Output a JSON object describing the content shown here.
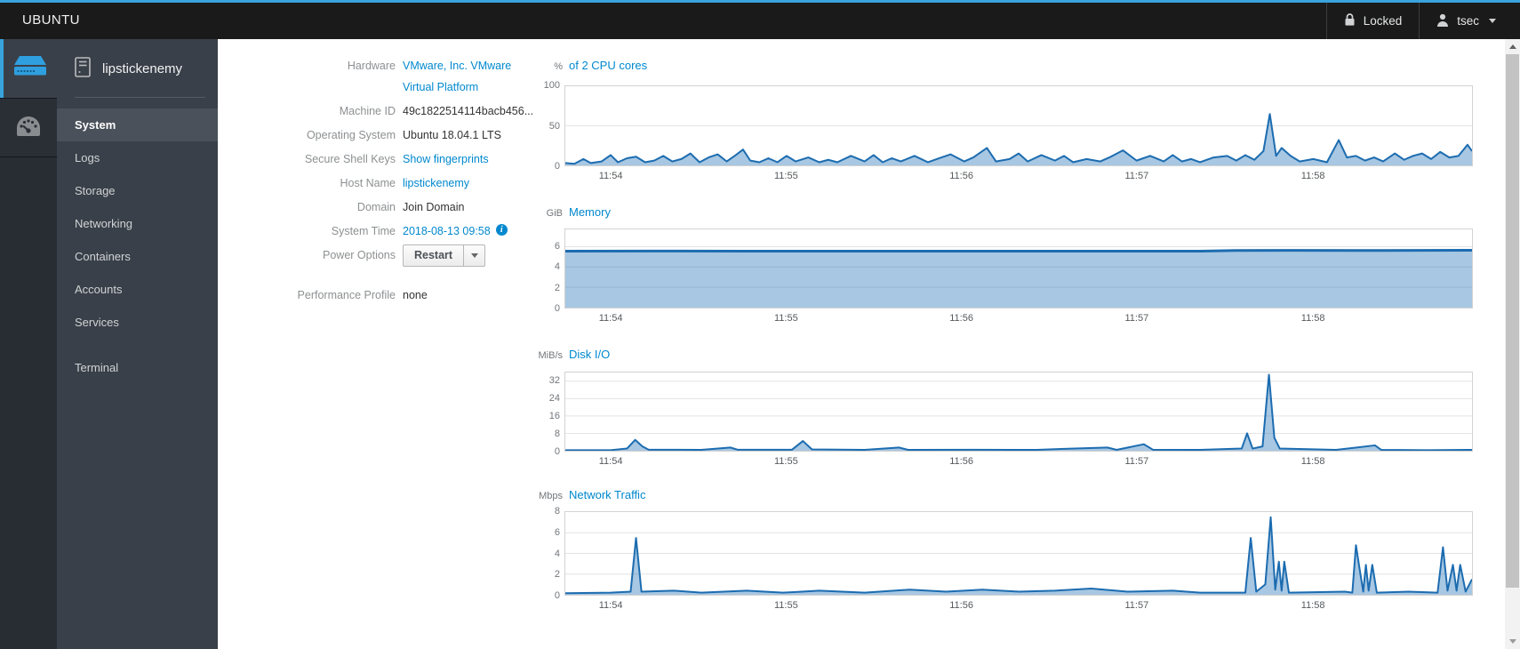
{
  "masthead": {
    "brand": "UBUNTU",
    "locked_label": "Locked",
    "user": "tsec"
  },
  "sidebar": {
    "host": "lipstickenemy",
    "items": [
      {
        "label": "System",
        "selected": true
      },
      {
        "label": "Logs"
      },
      {
        "label": "Storage"
      },
      {
        "label": "Networking"
      },
      {
        "label": "Containers"
      },
      {
        "label": "Accounts"
      },
      {
        "label": "Services"
      },
      {
        "label": "Terminal",
        "separated": true
      }
    ]
  },
  "system": {
    "fields": [
      {
        "key": "hardware",
        "label": "Hardware",
        "lines": [
          "VMware, Inc. VMware",
          "Virtual Platform"
        ],
        "style": "link",
        "interactable": true
      },
      {
        "key": "machine-id",
        "label": "Machine ID",
        "value": "49c1822514114bacb456...",
        "style": "text",
        "interactable": false
      },
      {
        "key": "operating-system",
        "label": "Operating System",
        "value": "Ubuntu 18.04.1 LTS",
        "style": "text",
        "interactable": false
      },
      {
        "key": "secure-shell-keys",
        "label": "Secure Shell Keys",
        "value": "Show fingerprints",
        "style": "link",
        "interactable": true
      },
      {
        "key": "host-name",
        "label": "Host Name",
        "value": "lipstickenemy",
        "style": "link",
        "interactable": true
      },
      {
        "key": "domain",
        "label": "Domain",
        "value": "Join Domain",
        "style": "text",
        "interactable": true
      },
      {
        "key": "system-time",
        "label": "System Time",
        "value": "2018-08-13 09:58",
        "style": "link",
        "icon": "info-icon",
        "interactable": true
      },
      {
        "key": "power-options",
        "label": "Power Options",
        "value": "Restart",
        "style": "button",
        "interactable": true
      },
      {
        "key": "performance-profile",
        "label": "Performance Profile",
        "value": "none",
        "style": "text",
        "interactable": false
      }
    ]
  },
  "chart_data": [
    {
      "type": "area",
      "id": "cpu",
      "unit": "%",
      "title": "of 2 CPU cores",
      "ylabel": "percent",
      "ylim": [
        0,
        100
      ],
      "yticks": [
        100,
        50,
        0
      ],
      "grid": true,
      "legend": "none",
      "x_labels": [
        "11:54",
        "11:55",
        "11:56",
        "11:57",
        "11:58"
      ],
      "x_label_fracs": [
        0.051,
        0.244,
        0.437,
        0.63,
        0.824
      ],
      "series": [
        [
          0,
          3
        ],
        [
          0.01,
          2
        ],
        [
          0.02,
          8
        ],
        [
          0.028,
          3
        ],
        [
          0.04,
          5
        ],
        [
          0.05,
          13
        ],
        [
          0.058,
          4
        ],
        [
          0.068,
          9
        ],
        [
          0.078,
          11
        ],
        [
          0.088,
          4
        ],
        [
          0.098,
          6
        ],
        [
          0.108,
          12
        ],
        [
          0.118,
          5
        ],
        [
          0.128,
          8
        ],
        [
          0.138,
          15
        ],
        [
          0.148,
          4
        ],
        [
          0.158,
          10
        ],
        [
          0.168,
          14
        ],
        [
          0.178,
          5
        ],
        [
          0.188,
          13
        ],
        [
          0.196,
          20
        ],
        [
          0.204,
          6
        ],
        [
          0.214,
          4
        ],
        [
          0.224,
          9
        ],
        [
          0.234,
          4
        ],
        [
          0.244,
          12
        ],
        [
          0.254,
          5
        ],
        [
          0.268,
          10
        ],
        [
          0.28,
          4
        ],
        [
          0.29,
          7
        ],
        [
          0.3,
          4
        ],
        [
          0.315,
          12
        ],
        [
          0.33,
          5
        ],
        [
          0.34,
          13
        ],
        [
          0.35,
          4
        ],
        [
          0.36,
          9
        ],
        [
          0.37,
          5
        ],
        [
          0.385,
          12
        ],
        [
          0.4,
          4
        ],
        [
          0.41,
          8
        ],
        [
          0.425,
          14
        ],
        [
          0.44,
          5
        ],
        [
          0.45,
          10
        ],
        [
          0.465,
          22
        ],
        [
          0.475,
          5
        ],
        [
          0.49,
          8
        ],
        [
          0.5,
          15
        ],
        [
          0.51,
          5
        ],
        [
          0.525,
          13
        ],
        [
          0.54,
          6
        ],
        [
          0.55,
          12
        ],
        [
          0.56,
          4
        ],
        [
          0.575,
          8
        ],
        [
          0.59,
          5
        ],
        [
          0.6,
          10
        ],
        [
          0.615,
          19
        ],
        [
          0.63,
          6
        ],
        [
          0.645,
          12
        ],
        [
          0.66,
          5
        ],
        [
          0.67,
          13
        ],
        [
          0.68,
          5
        ],
        [
          0.69,
          8
        ],
        [
          0.7,
          4
        ],
        [
          0.715,
          10
        ],
        [
          0.73,
          12
        ],
        [
          0.74,
          6
        ],
        [
          0.75,
          13
        ],
        [
          0.76,
          7
        ],
        [
          0.77,
          18
        ],
        [
          0.777,
          65
        ],
        [
          0.784,
          12
        ],
        [
          0.79,
          22
        ],
        [
          0.8,
          12
        ],
        [
          0.81,
          5
        ],
        [
          0.825,
          8
        ],
        [
          0.84,
          4
        ],
        [
          0.853,
          32
        ],
        [
          0.862,
          10
        ],
        [
          0.872,
          12
        ],
        [
          0.882,
          6
        ],
        [
          0.892,
          10
        ],
        [
          0.902,
          5
        ],
        [
          0.915,
          15
        ],
        [
          0.925,
          7
        ],
        [
          0.935,
          12
        ],
        [
          0.945,
          15
        ],
        [
          0.955,
          8
        ],
        [
          0.965,
          17
        ],
        [
          0.975,
          10
        ],
        [
          0.985,
          12
        ],
        [
          0.995,
          26
        ],
        [
          1,
          18
        ]
      ]
    },
    {
      "type": "area",
      "id": "memory",
      "unit": "GiB",
      "title": "Memory",
      "ylabel": "GiB used",
      "ylim": [
        0,
        7.7
      ],
      "yticks": [
        6,
        4,
        2,
        0
      ],
      "grid": true,
      "legend": "none",
      "x_labels": [
        "11:54",
        "11:55",
        "11:56",
        "11:57",
        "11:58"
      ],
      "x_label_fracs": [
        0.051,
        0.244,
        0.437,
        0.63,
        0.824
      ],
      "series": [
        [
          0,
          5.55
        ],
        [
          0.1,
          5.57
        ],
        [
          0.2,
          5.55
        ],
        [
          0.3,
          5.56
        ],
        [
          0.4,
          5.55
        ],
        [
          0.5,
          5.56
        ],
        [
          0.6,
          5.55
        ],
        [
          0.7,
          5.55
        ],
        [
          0.74,
          5.62
        ],
        [
          0.8,
          5.63
        ],
        [
          0.9,
          5.62
        ],
        [
          1,
          5.65
        ]
      ]
    },
    {
      "type": "area",
      "id": "disk",
      "unit": "MiB/s",
      "title": "Disk I/O",
      "ylabel": "MiB per second",
      "ylim": [
        0,
        36
      ],
      "yticks": [
        32,
        24,
        16,
        8,
        0
      ],
      "grid": true,
      "legend": "none",
      "x_labels": [
        "11:54",
        "11:55",
        "11:56",
        "11:57",
        "11:58"
      ],
      "x_label_fracs": [
        0.051,
        0.244,
        0.437,
        0.63,
        0.824
      ],
      "series": [
        [
          0,
          0.3
        ],
        [
          0.05,
          0.3
        ],
        [
          0.068,
          1
        ],
        [
          0.077,
          5
        ],
        [
          0.085,
          2
        ],
        [
          0.092,
          0.5
        ],
        [
          0.15,
          0.4
        ],
        [
          0.182,
          1.5
        ],
        [
          0.19,
          0.5
        ],
        [
          0.25,
          0.5
        ],
        [
          0.262,
          4.5
        ],
        [
          0.272,
          0.6
        ],
        [
          0.33,
          0.4
        ],
        [
          0.368,
          1.5
        ],
        [
          0.378,
          0.4
        ],
        [
          0.45,
          0.5
        ],
        [
          0.52,
          0.4
        ],
        [
          0.55,
          0.9
        ],
        [
          0.598,
          1.5
        ],
        [
          0.608,
          0.4
        ],
        [
          0.638,
          3
        ],
        [
          0.648,
          0.5
        ],
        [
          0.7,
          0.4
        ],
        [
          0.746,
          1
        ],
        [
          0.752,
          8
        ],
        [
          0.758,
          1
        ],
        [
          0.769,
          2
        ],
        [
          0.776,
          35
        ],
        [
          0.782,
          6
        ],
        [
          0.788,
          1
        ],
        [
          0.85,
          0.4
        ],
        [
          0.893,
          2.5
        ],
        [
          0.9,
          0.4
        ],
        [
          0.95,
          0.3
        ],
        [
          1,
          0.4
        ]
      ]
    },
    {
      "type": "area",
      "id": "network",
      "unit": "Mbps",
      "title": "Network Traffic",
      "ylabel": "Mbps",
      "ylim": [
        0,
        8
      ],
      "yticks": [
        8,
        6,
        4,
        2,
        0
      ],
      "grid": true,
      "legend": "none",
      "x_labels": [
        "11:54",
        "11:55",
        "11:56",
        "11:57",
        "11:58"
      ],
      "x_label_fracs": [
        0.051,
        0.244,
        0.437,
        0.63,
        0.824
      ],
      "series": [
        [
          0,
          0.15
        ],
        [
          0.05,
          0.2
        ],
        [
          0.072,
          0.3
        ],
        [
          0.078,
          5.5
        ],
        [
          0.084,
          0.3
        ],
        [
          0.12,
          0.4
        ],
        [
          0.15,
          0.2
        ],
        [
          0.2,
          0.4
        ],
        [
          0.24,
          0.2
        ],
        [
          0.28,
          0.4
        ],
        [
          0.33,
          0.2
        ],
        [
          0.38,
          0.5
        ],
        [
          0.42,
          0.3
        ],
        [
          0.46,
          0.5
        ],
        [
          0.5,
          0.3
        ],
        [
          0.54,
          0.4
        ],
        [
          0.58,
          0.6
        ],
        [
          0.62,
          0.3
        ],
        [
          0.67,
          0.4
        ],
        [
          0.7,
          0.2
        ],
        [
          0.75,
          0.2
        ],
        [
          0.756,
          5.5
        ],
        [
          0.762,
          0.3
        ],
        [
          0.772,
          1
        ],
        [
          0.778,
          7.5
        ],
        [
          0.783,
          0.5
        ],
        [
          0.787,
          3.2
        ],
        [
          0.79,
          0.4
        ],
        [
          0.793,
          3.2
        ],
        [
          0.798,
          0.2
        ],
        [
          0.86,
          0.3
        ],
        [
          0.868,
          0.2
        ],
        [
          0.872,
          4.8
        ],
        [
          0.876,
          2.5
        ],
        [
          0.88,
          0.3
        ],
        [
          0.883,
          2.9
        ],
        [
          0.886,
          0.4
        ],
        [
          0.89,
          2.9
        ],
        [
          0.895,
          0.2
        ],
        [
          0.93,
          0.3
        ],
        [
          0.962,
          0.2
        ],
        [
          0.968,
          4.6
        ],
        [
          0.973,
          0.4
        ],
        [
          0.979,
          2.9
        ],
        [
          0.983,
          0.4
        ],
        [
          0.987,
          2.9
        ],
        [
          0.993,
          0.3
        ],
        [
          1,
          1.5
        ]
      ]
    }
  ],
  "colors": {
    "accent_blue": "#39a3dd",
    "link_blue": "#0088ce",
    "masthead_bg": "#1a1a1a",
    "sidebar_bg": "#3a4049",
    "sidebar_strip_bg": "#282d33",
    "nav_selected_bg": "#4a515a",
    "chart_line": "#1c6cb0",
    "chart_fill": "rgba(26,108,178,0.38)",
    "grid_line": "#e3e3e3"
  }
}
